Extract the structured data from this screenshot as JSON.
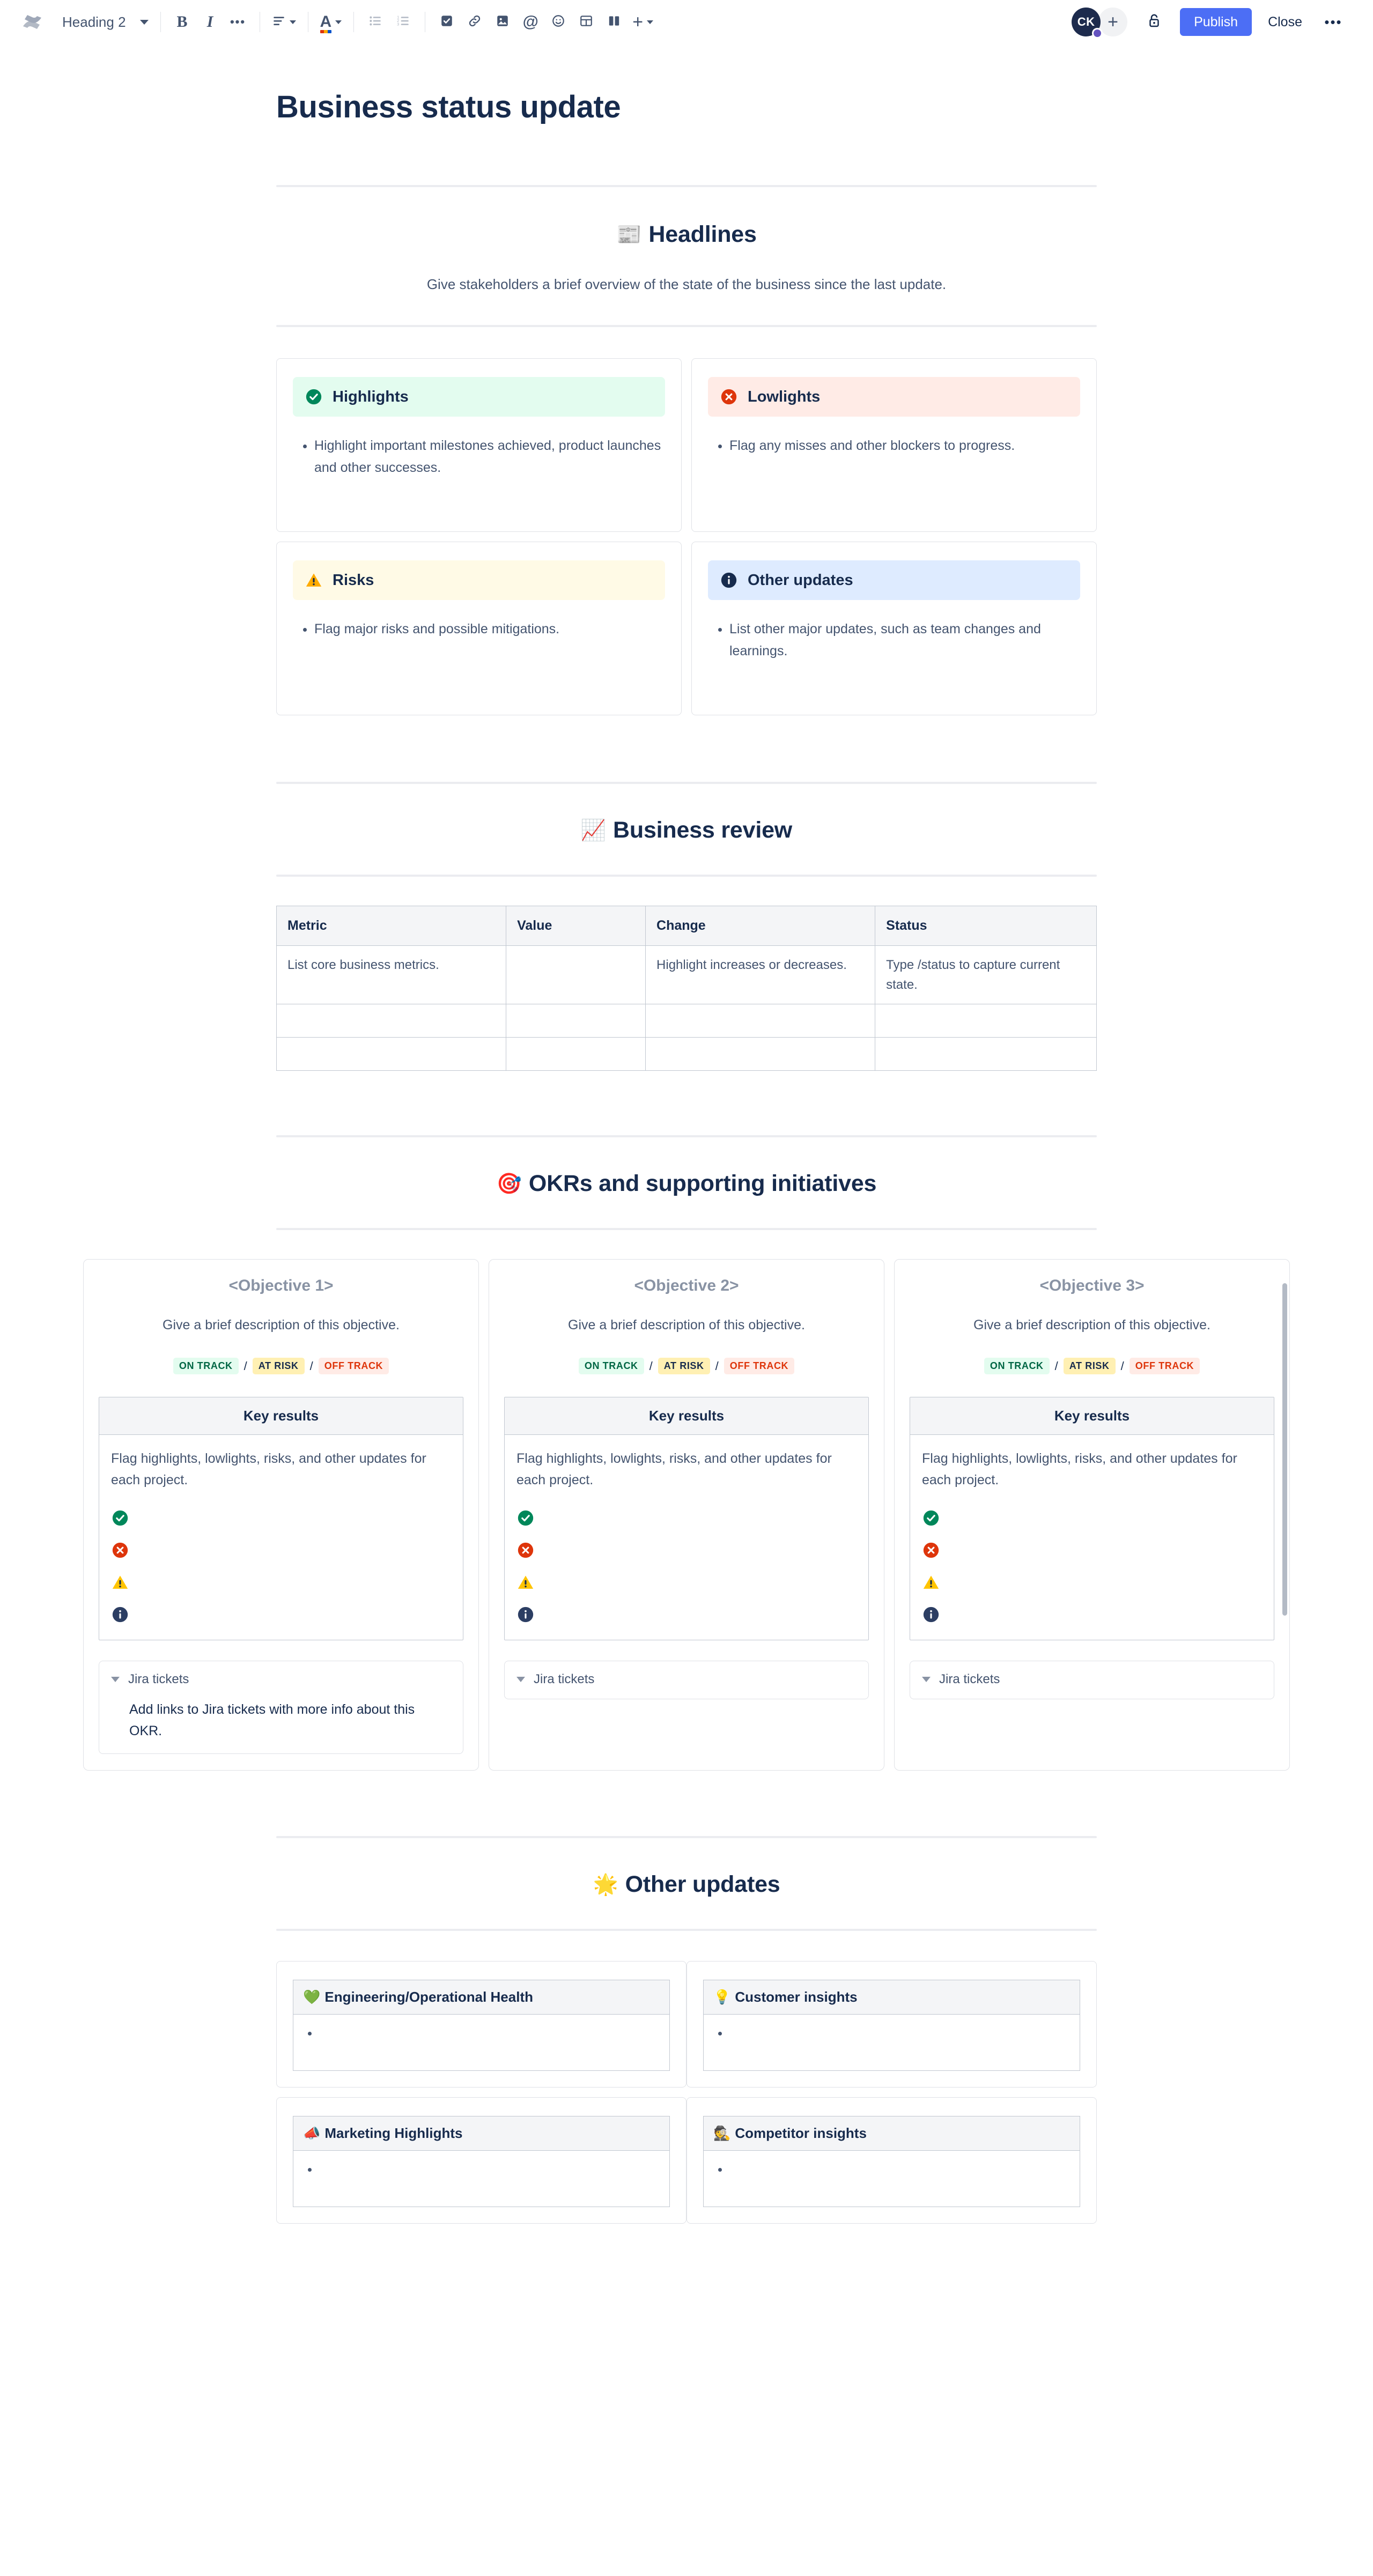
{
  "toolbar": {
    "logo_name": "confluence-logo",
    "block_type": "Heading 2",
    "buttons": {
      "bold": "B",
      "italic": "I",
      "more_formatting": "•••",
      "text_align": "align-left-icon",
      "text_color": "A",
      "bullet_list": "bullet-list-icon",
      "numbered_list": "numbered-list-icon",
      "task": "task-checkbox-icon",
      "link": "link-icon",
      "image": "image-icon",
      "mention": "@",
      "emoji": "emoji-icon",
      "table": "table-icon",
      "layout": "layout-columns-icon",
      "insert": "+"
    },
    "avatar_initials": "CK",
    "add_collaborator": "+",
    "restrictions": "lock-icon",
    "publish_label": "Publish",
    "close_label": "Close",
    "more_label": "•••"
  },
  "page": {
    "title": "Business status update"
  },
  "headlines": {
    "emoji": "📰",
    "heading": "Headlines",
    "lead": "Give stakeholders a brief overview of the state of the business since the last update.",
    "panels": [
      {
        "type": "success",
        "icon": "check-circle-icon",
        "title": "Highlights",
        "bullets": [
          "Highlight important milestones achieved, product launches and other successes."
        ]
      },
      {
        "type": "error",
        "icon": "cross-circle-icon",
        "title": "Lowlights",
        "bullets": [
          "Flag any misses and other blockers to progress."
        ]
      },
      {
        "type": "warning",
        "icon": "warning-triangle-icon",
        "title": "Risks",
        "bullets": [
          "Flag major risks and possible mitigations."
        ]
      },
      {
        "type": "info",
        "icon": "info-circle-icon",
        "title": "Other updates",
        "bullets": [
          "List other major updates, such as team changes and learnings."
        ]
      }
    ]
  },
  "business_review": {
    "emoji": "📈",
    "heading": "Business review",
    "table": {
      "columns": [
        "Metric",
        "Value",
        "Change",
        "Status"
      ],
      "rows": [
        [
          "List core business metrics.",
          "",
          "Highlight increases or decreases.",
          "Type /status to capture current state."
        ],
        [
          "",
          "",
          "",
          ""
        ],
        [
          "",
          "",
          "",
          ""
        ]
      ]
    }
  },
  "okrs": {
    "emoji": "🎯",
    "heading": "OKRs and supporting initiatives",
    "status_options": [
      {
        "label": "ON TRACK",
        "tone": "green"
      },
      {
        "label": "AT RISK",
        "tone": "yellow"
      },
      {
        "label": "OFF TRACK",
        "tone": "red"
      }
    ],
    "separator": "/",
    "key_results_header": "Key results",
    "key_results_text": "Flag highlights, lowlights, risks, and other updates for each project.",
    "key_result_icons": [
      "check-circle-icon",
      "cross-circle-icon",
      "warning-triangle-icon",
      "info-circle-icon"
    ],
    "expand_label": "Jira tickets",
    "cards": [
      {
        "title": "<Objective 1>",
        "description": "Give a brief description of this objective.",
        "expand_body": "Add links to Jira tickets with more info about this OKR."
      },
      {
        "title": "<Objective 2>",
        "description": "Give a brief description of this objective.",
        "expand_body": ""
      },
      {
        "title": "<Objective 3>",
        "description": "Give a brief description of this objective.",
        "expand_body": ""
      }
    ]
  },
  "other_updates": {
    "emoji": "🌟",
    "heading": "Other updates",
    "cards": [
      {
        "emoji": "💚",
        "title": "Engineering/Operational Health",
        "bullets": [
          ""
        ]
      },
      {
        "emoji": "💡",
        "title": "Customer insights",
        "bullets": [
          ""
        ]
      },
      {
        "emoji": "📣",
        "title": "Marketing Highlights",
        "bullets": [
          ""
        ]
      },
      {
        "emoji": "🕵️",
        "title": "Competitor insights",
        "bullets": [
          ""
        ]
      }
    ]
  },
  "colors": {
    "brand": "#4C6EF5",
    "text": "#172B4D",
    "subtle_text": "#44546F",
    "success": "#006644",
    "error": "#DE350B",
    "warning": "#FFAB00",
    "info": "#172B4D",
    "border": "#DFE1E6"
  }
}
